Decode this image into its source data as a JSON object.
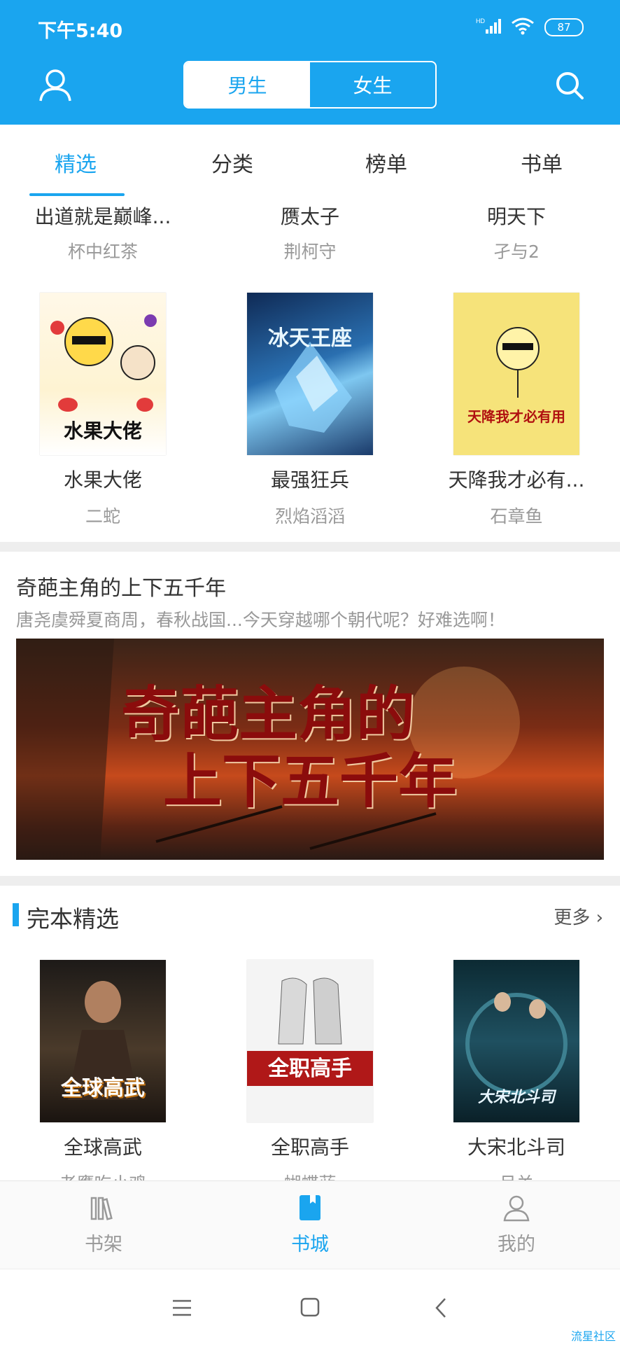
{
  "status": {
    "time": "下午5:40",
    "network": "HD",
    "battery": "87"
  },
  "header": {
    "tabs": [
      {
        "label": "男生",
        "active": true
      },
      {
        "label": "女生",
        "active": false
      }
    ]
  },
  "subtabs": [
    "精选",
    "分类",
    "榜单",
    "书单"
  ],
  "books_top": [
    {
      "title": "出道就是巅峰...",
      "author": "杯中红茶"
    },
    {
      "title": "赝太子",
      "author": "荆柯守"
    },
    {
      "title": "明天下",
      "author": "孑与2"
    }
  ],
  "books_row2": [
    {
      "title": "水果大佬",
      "author": "二蛇",
      "cover_text": "水果大佬"
    },
    {
      "title": "最强狂兵",
      "author": "烈焰滔滔",
      "cover_text": "冰天王座"
    },
    {
      "title": "天降我才必有...",
      "author": "石章鱼",
      "cover_text": "天降我才必有用"
    }
  ],
  "topic": {
    "title": "奇葩主角的上下五千年",
    "subtitle": "唐尧虞舜夏商周，春秋战国...今天穿越哪个朝代呢？好难选啊！",
    "banner_line1": "奇葩主角的",
    "banner_line2": "上下五千年"
  },
  "section": {
    "title": "完本精选",
    "more": "更多"
  },
  "books_finished": [
    {
      "title": "全球高武",
      "author": "老鹰吃小鸡",
      "cover_text": "全球高武"
    },
    {
      "title": "全职高手",
      "author": "蝴蝶蓝",
      "cover_text": "全职高手"
    },
    {
      "title": "大宋北斗司",
      "author": "月关",
      "cover_text": "大宋北斗司"
    }
  ],
  "bottom_nav": [
    {
      "label": "书架",
      "icon": "bookshelf-icon",
      "active": false
    },
    {
      "label": "书城",
      "icon": "bookstore-icon",
      "active": true
    },
    {
      "label": "我的",
      "icon": "profile-icon",
      "active": false
    }
  ],
  "watermark": "流星社区",
  "colors": {
    "accent": "#1aa5ef",
    "divider": "#eeeeee"
  }
}
